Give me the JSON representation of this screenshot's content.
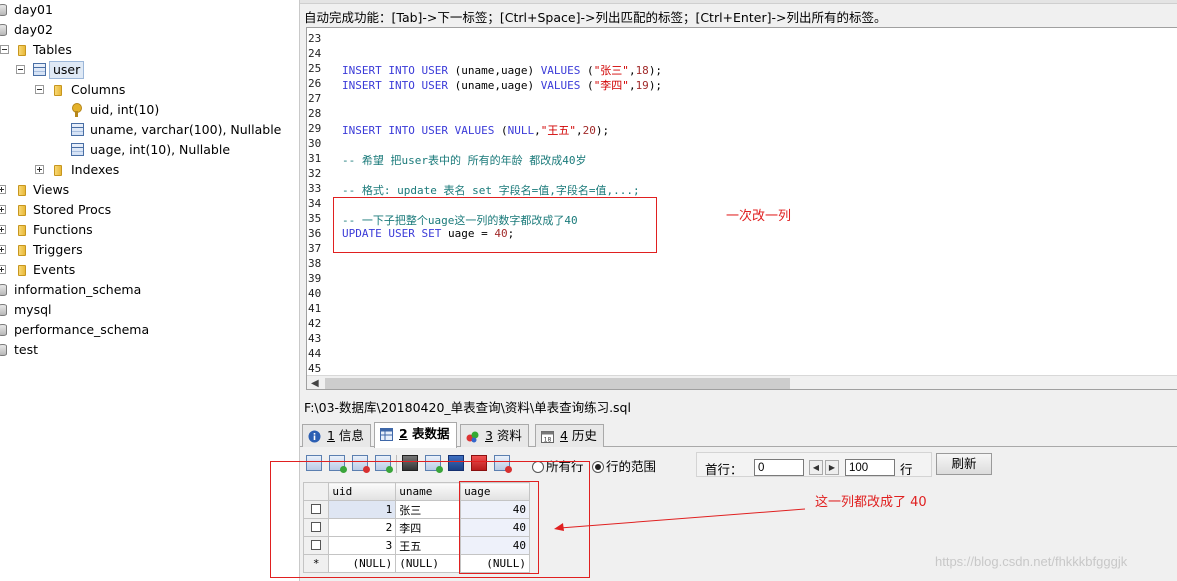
{
  "tree": {
    "databases_top": [
      "day01",
      "day02"
    ],
    "tables_label": "Tables",
    "table_user": "user",
    "columns_label": "Columns",
    "columns": [
      "uid, int(10)",
      "uname, varchar(100), Nullable",
      "uage, int(10), Nullable"
    ],
    "indexes_label": "Indexes",
    "folders": [
      "Views",
      "Stored Procs",
      "Functions",
      "Triggers",
      "Events"
    ],
    "databases_bottom": [
      "information_schema",
      "mysql",
      "performance_schema",
      "test"
    ]
  },
  "autocomplete_hint": "自动完成功能：[Tab]->下一标签；[Ctrl+Space]->列出匹配的标签；[Ctrl+Enter]->列出所有的标签。",
  "editor": {
    "line_numbers": [
      "23",
      "24",
      "25",
      "26",
      "27",
      "28",
      "29",
      "30",
      "31",
      "32",
      "33",
      "34",
      "35",
      "36",
      "37",
      "38",
      "39",
      "40",
      "41",
      "42",
      "43",
      "44",
      "45"
    ],
    "lines": {
      "l25": {
        "kw1": "INSERT INTO USER",
        "plain1": " (uname,uage) ",
        "kw2": "VALUES",
        "plain2": " (",
        "str": "\"张三\"",
        "plain3": ",",
        "num": "18",
        "plain4": ");"
      },
      "l26": {
        "kw1": "INSERT INTO USER",
        "plain1": " (uname,uage) ",
        "kw2": "VALUES",
        "plain2": " (",
        "str": "\"李四\"",
        "plain3": ",",
        "num": "19",
        "plain4": ");"
      },
      "l29": {
        "kw1": "INSERT INTO USER VALUES",
        "plain1": " (",
        "kw2": "NULL",
        "plain2": ",",
        "str": "\"王五\"",
        "plain3": ",",
        "num": "20",
        "plain4": ");"
      },
      "l31": "-- 希望 把user表中的 所有的年龄 都改成40岁",
      "l33": "-- 格式: update 表名 set 字段名=值,字段名=值,...;",
      "l35": "-- 一下子把整个uage这一列的数字都改成了40",
      "l36": {
        "kw1": "UPDATE USER SET",
        "plain1": " uage = ",
        "num": "40",
        "plain2": ";"
      }
    }
  },
  "file_path": "F:\\03-数据库\\20180420_单表查询\\资料\\单表查询练习.sql",
  "tabs": [
    {
      "num": "1",
      "label": " 信息"
    },
    {
      "num": "2",
      "label": " 表数据"
    },
    {
      "num": "3",
      "label": " 资料"
    },
    {
      "num": "4",
      "label": " 历史"
    }
  ],
  "toolbar": {
    "radio_all_rows": "所有行",
    "radio_range": "行的范围",
    "first_row_label": "首行：",
    "first_row_value": "0",
    "rows_value": "100",
    "rows_label": "行",
    "refresh": "刷新"
  },
  "grid": {
    "headers": [
      "uid",
      "uname",
      "uage"
    ],
    "rows": [
      [
        "1",
        "张三",
        "40"
      ],
      [
        "2",
        "李四",
        "40"
      ],
      [
        "3",
        "王五",
        "40"
      ]
    ],
    "null_row": [
      "(NULL)",
      "(NULL)",
      "(NULL)"
    ],
    "new_row_marker": "*"
  },
  "annotations": {
    "change_column": "一次改一列",
    "column_changed": "这一列都改成了 40"
  },
  "watermark": "https://blog.csdn.net/fhkkkbfgggjk",
  "colors": {
    "keyword": "#3b3bd8",
    "string": "#d10000",
    "comment": "#1a7a7a",
    "annotation": "#e02020"
  }
}
